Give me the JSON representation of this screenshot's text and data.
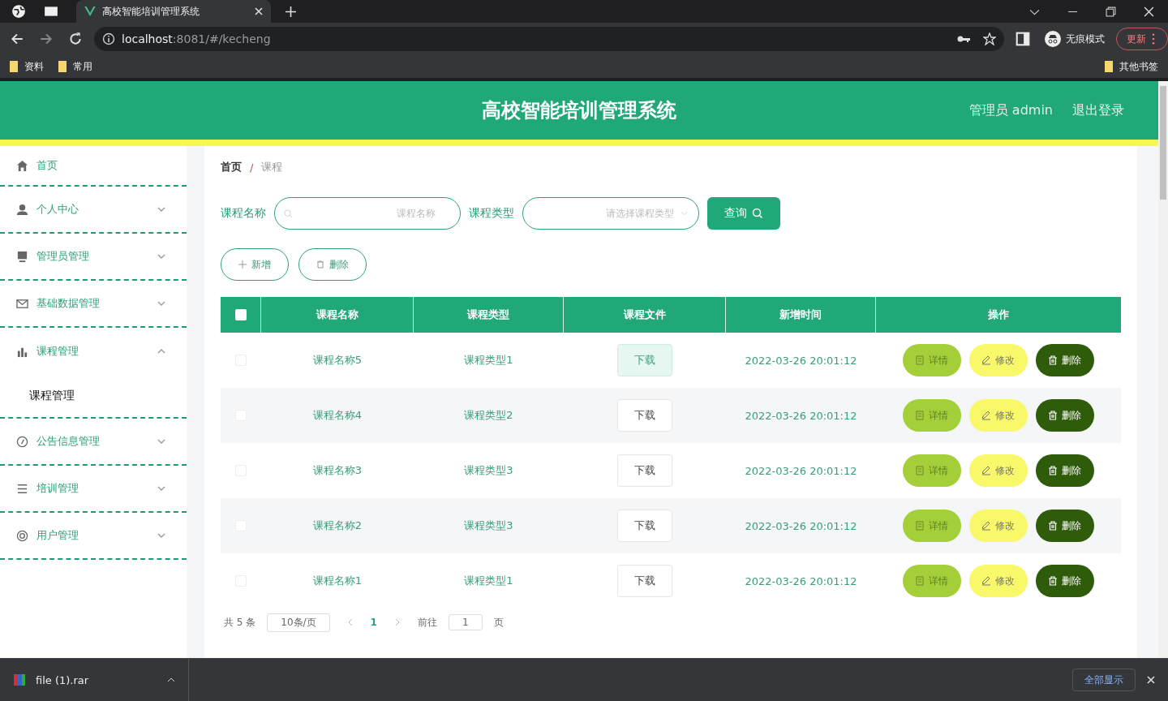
{
  "browser": {
    "tab_title": "高校智能培训管理系统",
    "url_host": "localhost",
    "url_path": ":8081/#/kecheng",
    "incognito_label": "无痕模式",
    "update_button": "更新",
    "bookmarks": [
      "资料",
      "常用"
    ],
    "other_bookmarks": "其他书签"
  },
  "header": {
    "title": "高校智能培训管理系统",
    "user": "管理员 admin",
    "logout": "退出登录"
  },
  "sidebar": {
    "items": [
      {
        "label": "首页"
      },
      {
        "label": "个人中心",
        "expanded": false
      },
      {
        "label": "管理员管理",
        "expanded": false
      },
      {
        "label": "基础数据管理",
        "expanded": false
      },
      {
        "label": "课程管理",
        "expanded": true,
        "children": [
          {
            "label": "课程管理",
            "selected": true
          }
        ]
      },
      {
        "label": "公告信息管理",
        "expanded": false
      },
      {
        "label": "培训管理",
        "expanded": false
      },
      {
        "label": "用户管理",
        "expanded": false
      }
    ]
  },
  "breadcrumb": {
    "home": "首页",
    "separator": "/",
    "current": "课程"
  },
  "search": {
    "name_label": "课程名称",
    "name_placeholder": "课程名称",
    "type_label": "课程类型",
    "type_placeholder": "请选择课程类型",
    "query_button": "查询"
  },
  "actions": {
    "add": "新增",
    "delete": "删除"
  },
  "table": {
    "select_all_checked": false,
    "columns": [
      "课程名称",
      "课程类型",
      "课程文件",
      "新增时间",
      "操作"
    ],
    "rows": [
      {
        "checked": false,
        "name": "课程名称5",
        "type": "课程类型1",
        "file": "下载",
        "file_highlighted": true,
        "time": "2022-03-26 20:01:12",
        "buttons": [
          {
            "kind": "detail",
            "label": "详情"
          },
          {
            "kind": "edit",
            "label": "修改"
          },
          {
            "kind": "delete",
            "label": "删除"
          }
        ]
      },
      {
        "checked": false,
        "name": "课程名称4",
        "type": "课程类型2",
        "file": "下载",
        "file_highlighted": false,
        "time": "2022-03-26 20:01:12",
        "buttons": [
          {
            "kind": "detail",
            "label": "详情"
          },
          {
            "kind": "edit",
            "label": "修改"
          },
          {
            "kind": "delete",
            "label": "删除"
          }
        ]
      },
      {
        "checked": false,
        "name": "课程名称3",
        "type": "课程类型3",
        "file": "下载",
        "file_highlighted": false,
        "time": "2022-03-26 20:01:12",
        "buttons": [
          {
            "kind": "detail",
            "label": "详情"
          },
          {
            "kind": "edit",
            "label": "修改"
          },
          {
            "kind": "delete",
            "label": "删除"
          }
        ]
      },
      {
        "checked": false,
        "name": "课程名称2",
        "type": "课程类型3",
        "file": "下载",
        "file_highlighted": false,
        "time": "2022-03-26 20:01:12",
        "buttons": [
          {
            "kind": "detail",
            "label": "详情"
          },
          {
            "kind": "edit",
            "label": "修改"
          },
          {
            "kind": "delete",
            "label": "删除"
          }
        ]
      },
      {
        "checked": false,
        "name": "课程名称1",
        "type": "课程类型1",
        "file": "下载",
        "file_highlighted": false,
        "time": "2022-03-26 20:01:12",
        "buttons": [
          {
            "kind": "detail",
            "label": "详情"
          },
          {
            "kind": "edit",
            "label": "修改"
          },
          {
            "kind": "delete",
            "label": "删除"
          }
        ]
      }
    ]
  },
  "pagination": {
    "total": "共 5 条",
    "page_size": "10条/页",
    "pages": [
      {
        "label": "1",
        "selected": true
      }
    ],
    "goto": "前往",
    "goto_value": "1",
    "page_unit": "页"
  },
  "download_bar": {
    "file": "file (1).rar",
    "show_all": "全部显示"
  }
}
